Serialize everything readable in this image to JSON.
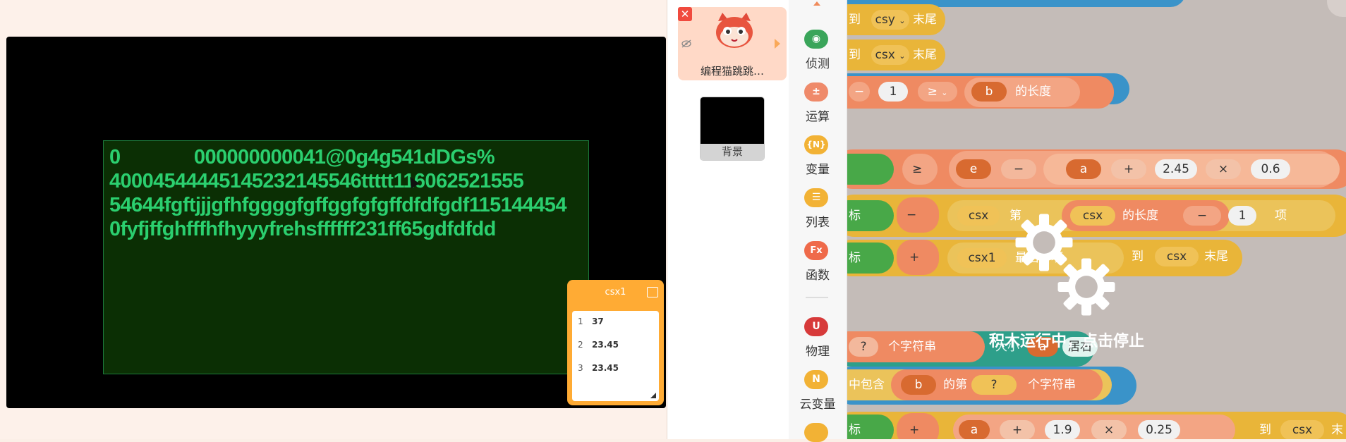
{
  "stage": {
    "text_lines": [
      "0              000000000041@0g4g541dDGs%",
      "40004544445145232145546ttttt116062521555",
      "54644fgftjjjgfhfggggfgffggfgfgffdfdfgdf115144454",
      "0fyfjffghfffhfhyyyfrehsffffff231ff65gdfdfdd"
    ],
    "list_monitor": {
      "title": "csx1",
      "items": [
        {
          "index": "1",
          "value": "37"
        },
        {
          "index": "2",
          "value": "23.45"
        },
        {
          "index": "3",
          "value": "23.45"
        }
      ]
    }
  },
  "sprites": {
    "close": "✕",
    "sprite_name": "编程猫跳跳…",
    "background_label": "背景"
  },
  "categories": [
    {
      "label": "侦测",
      "icon": "detect-icon",
      "color": "#3aa55a",
      "glyph": "◉"
    },
    {
      "label": "运算",
      "icon": "operator-icon",
      "color": "#ef8a6a",
      "glyph": "±"
    },
    {
      "label": "变量",
      "icon": "variable-icon",
      "color": "#f2b235",
      "glyph": "{N}"
    },
    {
      "label": "列表",
      "icon": "list-icon",
      "color": "#f2b235",
      "glyph": "☰"
    },
    {
      "label": "函数",
      "icon": "function-icon",
      "color": "#ef6a4a",
      "glyph": "Fx"
    },
    {
      "label": "物理",
      "icon": "physics-icon",
      "color": "#d73a3a",
      "glyph": "U"
    },
    {
      "label": "云变量",
      "icon": "cloud-variable-icon",
      "color": "#f2b235",
      "glyph": "N"
    }
  ],
  "blocks": {
    "row1": {
      "to": "到",
      "var": "csy",
      "end": "末尾"
    },
    "row2": {
      "to": "到",
      "var": "csx",
      "end": "末尾"
    },
    "row3": {
      "op": "−",
      "num": "1",
      "cmp": "≥",
      "var": "b",
      "len": "的长度"
    },
    "row4": {
      "cmp": "≥",
      "e": "e",
      "op1": "−",
      "a": "a",
      "op2": "+",
      "n1": "2.45",
      "op3": "×",
      "n2": "0.6"
    },
    "row5": {
      "lbl": "标",
      "op": "−",
      "v1": "csx",
      "nth": "第",
      "v2": "csx",
      "len": "的长度",
      "op2": "−",
      "n": "1",
      "item": "项"
    },
    "row6": {
      "lbl": "标",
      "op": "+",
      "v1": "csx1",
      "last": "最后一项",
      "to": "到",
      "v2": "csx",
      "end": "末尾"
    },
    "row7": {
      "q": "?",
      "chars": "个字符串",
      "size": "大小",
      "a": "a",
      "align": "居右"
    },
    "row8": {
      "contain": "中包含",
      "b": "b",
      "nth": "的第",
      "q": "?",
      "chars": "个字符串"
    },
    "row9": {
      "lbl": "标",
      "op": "+",
      "a": "a",
      "op2": "+",
      "n1": "1.9",
      "op3": "×",
      "n2": "0.25",
      "to": "到",
      "v": "csx",
      "end": "末"
    }
  },
  "overlay": {
    "text": "积木运行中，点击停止"
  }
}
